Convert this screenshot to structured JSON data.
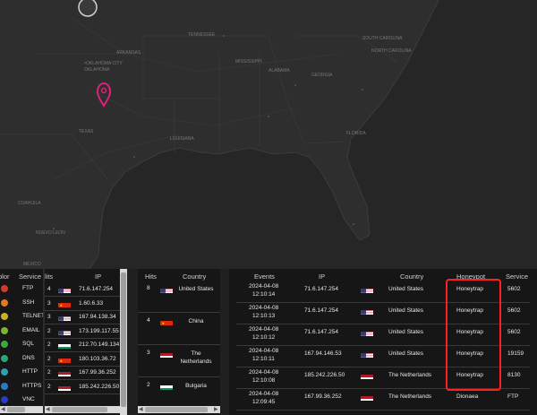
{
  "colors": {
    "highlight_box": "#ff2020",
    "map_pin": "#e0207a"
  },
  "map": {
    "states": [
      "OKLAHOMA CITY",
      "OKLAHOMA",
      "TEXAS",
      "LOUISIANA",
      "MISSISSIPPI",
      "ALABAMA",
      "GEORGIA",
      "FLORIDA",
      "SOUTH CAROLINA",
      "NORTH CAROLINA",
      "TENNESSEE",
      "ARKANSAS",
      "COAHUILA",
      "NUEVO LEON",
      "MEXICO"
    ]
  },
  "service_panel": {
    "headers": {
      "color": "olor",
      "service": "Service"
    },
    "rows": [
      {
        "color": "#d43a2a",
        "service": "FTP"
      },
      {
        "color": "#e07a22",
        "service": "SSH"
      },
      {
        "color": "#c9b12a",
        "service": "TELNET"
      },
      {
        "color": "#7ab32e",
        "service": "EMAIL"
      },
      {
        "color": "#3fa83a",
        "service": "SQL"
      },
      {
        "color": "#2aa47a",
        "service": "DNS"
      },
      {
        "color": "#2aa2b2",
        "service": "HTTP"
      },
      {
        "color": "#2a7ac4",
        "service": "HTTPS"
      },
      {
        "color": "#2a3ac4",
        "service": "VNC"
      }
    ]
  },
  "ip_panel": {
    "headers": {
      "hits": "lits",
      "ip": "IP"
    },
    "rows": [
      {
        "hits": "4",
        "flag": "us",
        "ip": "71.6.147.254"
      },
      {
        "hits": "3",
        "flag": "cn",
        "ip": "1.60.6.33"
      },
      {
        "hits": "3",
        "flag": "us",
        "ip": "167.94.138.34"
      },
      {
        "hits": "2",
        "flag": "us",
        "ip": "173.199.117.55"
      },
      {
        "hits": "2",
        "flag": "bg",
        "ip": "212.70.149.134"
      },
      {
        "hits": "2",
        "flag": "cn",
        "ip": "180.103.36.72"
      },
      {
        "hits": "2",
        "flag": "nl",
        "ip": "167.99.36.252"
      },
      {
        "hits": "2",
        "flag": "nl",
        "ip": "185.242.226.50"
      }
    ]
  },
  "country_panel": {
    "headers": {
      "hits": "Hits",
      "country": "Country"
    },
    "rows": [
      {
        "hits": "8",
        "flag": "us",
        "country": "United States"
      },
      {
        "hits": "4",
        "flag": "cn",
        "country": "China"
      },
      {
        "hits": "3",
        "flag": "nl",
        "country": "The Netherlands"
      },
      {
        "hits": "2",
        "flag": "bg",
        "country": "Bulgaria"
      }
    ]
  },
  "events_panel": {
    "headers": {
      "events": "Events",
      "ip": "IP",
      "country": "Country",
      "honeypot": "Honeypot",
      "service": "Service"
    },
    "rows": [
      {
        "date": "2024-04-08",
        "time": "12:10:14",
        "ip": "71.6.147.254",
        "flag": "us",
        "country": "United States",
        "honeypot": "Honeytrap",
        "service": "5602"
      },
      {
        "date": "2024-04-08",
        "time": "12:10:13",
        "ip": "71.6.147.254",
        "flag": "us",
        "country": "United States",
        "honeypot": "Honeytrap",
        "service": "5602"
      },
      {
        "date": "2024-04-08",
        "time": "12:10:12",
        "ip": "71.6.147.254",
        "flag": "us",
        "country": "United States",
        "honeypot": "Honeytrap",
        "service": "5602"
      },
      {
        "date": "2024-04-08",
        "time": "12:10:11",
        "ip": "167.94.146.53",
        "flag": "us",
        "country": "United States",
        "honeypot": "Honeytrap",
        "service": "19159"
      },
      {
        "date": "2024-04-08",
        "time": "12:10:08",
        "ip": "185.242.226.50",
        "flag": "nl",
        "country": "The Netherlands",
        "honeypot": "Honeytrap",
        "service": "8130"
      },
      {
        "date": "2024-04-08",
        "time": "12:09:45",
        "ip": "167.99.36.252",
        "flag": "nl",
        "country": "The Netherlands",
        "honeypot": "Dionaea",
        "service": "FTP"
      }
    ]
  }
}
